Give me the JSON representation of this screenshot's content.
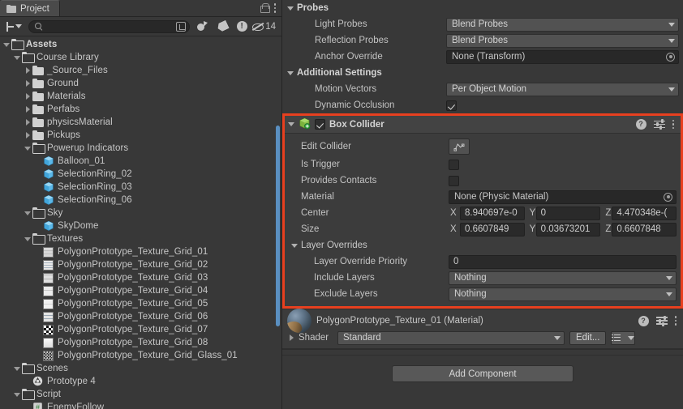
{
  "project_panel": {
    "tab_label": "Project",
    "tab_icon": "folder-icon",
    "lock_icon": "lock-icon",
    "menu_icon": "kebab-menu-icon",
    "toolbar": {
      "create_label": "+",
      "search_placeholder": "",
      "search_value": "",
      "search_icon": "search-icon",
      "expand_search_icon": "expand-search-icon",
      "favorite_filter_icon": "favorite-filter-icon",
      "label_filter_icon": "label-tag-icon",
      "error_filter_icon": "error-filter-icon",
      "hidden_icon": "eye-off-icon",
      "hidden_count": "14"
    },
    "tree": [
      {
        "label": "Assets",
        "depth": 0,
        "icon": "folder-open-icon",
        "arrow": "open",
        "bold": true
      },
      {
        "label": "Course Library",
        "depth": 1,
        "icon": "folder-open-icon",
        "arrow": "open"
      },
      {
        "label": "_Source_Files",
        "depth": 2,
        "icon": "folder-closed-icon",
        "arrow": "closed"
      },
      {
        "label": "Ground",
        "depth": 2,
        "icon": "folder-closed-icon",
        "arrow": "closed"
      },
      {
        "label": "Materials",
        "depth": 2,
        "icon": "folder-closed-icon",
        "arrow": "closed"
      },
      {
        "label": "Perfabs",
        "depth": 2,
        "icon": "folder-closed-icon",
        "arrow": "closed"
      },
      {
        "label": "physicsMaterial",
        "depth": 2,
        "icon": "folder-closed-icon",
        "arrow": "closed"
      },
      {
        "label": "Pickups",
        "depth": 2,
        "icon": "folder-closed-icon",
        "arrow": "closed"
      },
      {
        "label": "Powerup Indicators",
        "depth": 2,
        "icon": "folder-open-icon",
        "arrow": "open"
      },
      {
        "label": "Balloon_01",
        "depth": 3,
        "icon": "prefab-icon",
        "arrow": "none"
      },
      {
        "label": "SelectionRing_02",
        "depth": 3,
        "icon": "prefab-icon",
        "arrow": "none"
      },
      {
        "label": "SelectionRing_03",
        "depth": 3,
        "icon": "prefab-icon",
        "arrow": "none"
      },
      {
        "label": "SelectionRing_06",
        "depth": 3,
        "icon": "prefab-icon",
        "arrow": "none"
      },
      {
        "label": "Sky",
        "depth": 2,
        "icon": "folder-open-icon",
        "arrow": "open"
      },
      {
        "label": "SkyDome",
        "depth": 3,
        "icon": "prefab-icon",
        "arrow": "none"
      },
      {
        "label": "Textures",
        "depth": 2,
        "icon": "folder-open-icon",
        "arrow": "open"
      },
      {
        "label": "PolygonPrototype_Texture_Grid_01",
        "depth": 3,
        "icon": "texture-icon",
        "arrow": "none",
        "tex": "grid01"
      },
      {
        "label": "PolygonPrototype_Texture_Grid_02",
        "depth": 3,
        "icon": "texture-icon",
        "arrow": "none",
        "tex": "grid02"
      },
      {
        "label": "PolygonPrototype_Texture_Grid_03",
        "depth": 3,
        "icon": "texture-icon",
        "arrow": "none",
        "tex": "grid03"
      },
      {
        "label": "PolygonPrototype_Texture_Grid_04",
        "depth": 3,
        "icon": "texture-icon",
        "arrow": "none",
        "tex": "grid04"
      },
      {
        "label": "PolygonPrototype_Texture_Grid_05",
        "depth": 3,
        "icon": "texture-icon",
        "arrow": "none",
        "tex": "grid05"
      },
      {
        "label": "PolygonPrototype_Texture_Grid_06",
        "depth": 3,
        "icon": "texture-icon",
        "arrow": "none",
        "tex": "grid06"
      },
      {
        "label": "PolygonPrototype_Texture_Grid_07",
        "depth": 3,
        "icon": "texture-icon",
        "arrow": "none",
        "tex": "grid07"
      },
      {
        "label": "PolygonPrototype_Texture_Grid_08",
        "depth": 3,
        "icon": "texture-icon",
        "arrow": "none",
        "tex": "grid08"
      },
      {
        "label": "PolygonPrototype_Texture_Grid_Glass_01",
        "depth": 3,
        "icon": "texture-icon",
        "arrow": "none",
        "tex": "glass"
      },
      {
        "label": "Scenes",
        "depth": 1,
        "icon": "folder-open-icon",
        "arrow": "open"
      },
      {
        "label": "Prototype 4",
        "depth": 2,
        "icon": "unity-scene-icon",
        "arrow": "none"
      },
      {
        "label": "Script",
        "depth": 1,
        "icon": "folder-open-icon",
        "arrow": "open"
      },
      {
        "label": "EnemyFollow",
        "depth": 2,
        "icon": "script-icon",
        "arrow": "none"
      }
    ]
  },
  "inspector": {
    "probes": {
      "title": "Probes",
      "light_probes": {
        "label": "Light Probes",
        "value": "Blend Probes"
      },
      "reflection_probes": {
        "label": "Reflection Probes",
        "value": "Blend Probes"
      },
      "anchor_override": {
        "label": "Anchor Override",
        "value": "None (Transform)"
      }
    },
    "additional_settings": {
      "title": "Additional Settings",
      "motion_vectors": {
        "label": "Motion Vectors",
        "value": "Per Object Motion"
      },
      "dynamic_occlusion": {
        "label": "Dynamic Occlusion",
        "checked": true
      }
    },
    "box_collider": {
      "title": "Box Collider",
      "enabled": true,
      "component_icon": "box-collider-icon",
      "help_icon": "help-icon",
      "preset_icon": "preset-icon",
      "menu_icon": "kebab-menu-icon",
      "edit_collider": {
        "label": "Edit Collider",
        "icon": "edit-collider-icon"
      },
      "is_trigger": {
        "label": "Is Trigger",
        "checked": false
      },
      "provides_contacts": {
        "label": "Provides Contacts",
        "checked": false
      },
      "material": {
        "label": "Material",
        "value": "None (Physic Material)"
      },
      "center": {
        "label": "Center",
        "x_axis": "X",
        "x": "8.940697e-0",
        "y_axis": "Y",
        "y": "0",
        "z_axis": "Z",
        "z": "4.470348e-("
      },
      "size": {
        "label": "Size",
        "x_axis": "X",
        "x": "0.6607849",
        "y_axis": "Y",
        "y": "0.03673201",
        "z_axis": "Z",
        "z": "0.6607848"
      },
      "layer_overrides": {
        "title": "Layer Overrides",
        "priority": {
          "label": "Layer Override Priority",
          "value": "0"
        },
        "include_layers": {
          "label": "Include Layers",
          "value": "Nothing"
        },
        "exclude_layers": {
          "label": "Exclude Layers",
          "value": "Nothing"
        }
      }
    },
    "material_preview": {
      "title": "PolygonPrototype_Texture_01 (Material)",
      "shader_label": "Shader",
      "shader_value": "Standard",
      "edit_button": "Edit...",
      "help_icon": "help-icon",
      "preset_icon": "preset-icon",
      "menu_icon": "kebab-menu-icon",
      "list_icon": "shader-list-icon"
    },
    "add_component": "Add Component"
  },
  "colors": {
    "highlight_border": "#e8401f",
    "panel_bg": "#383838",
    "scrollbar": "#5a8fc0"
  }
}
